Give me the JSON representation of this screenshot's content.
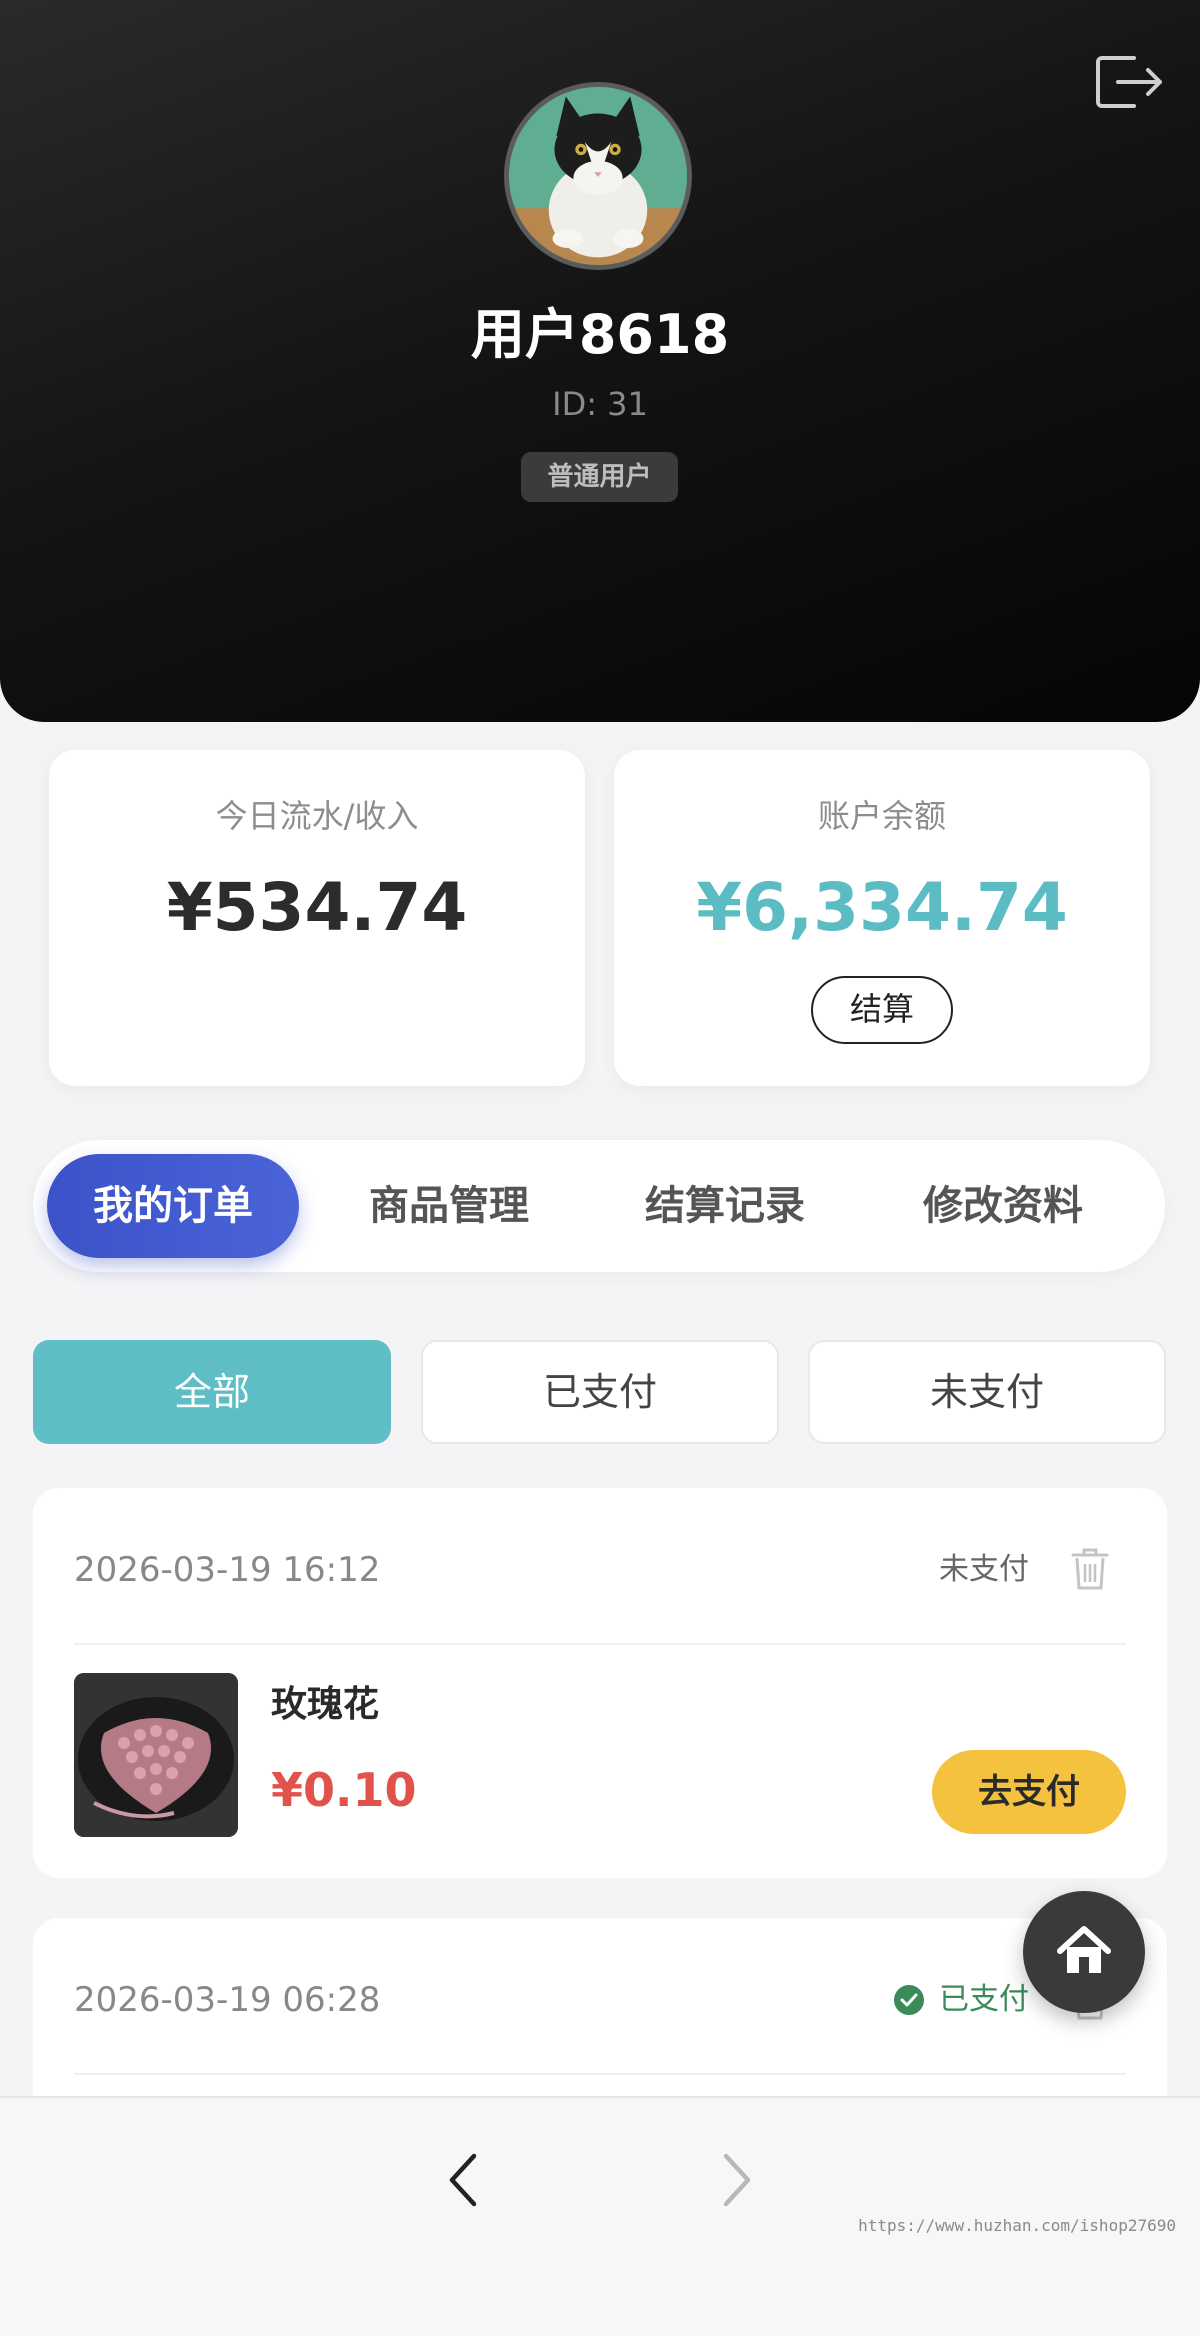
{
  "profile": {
    "name": "用户8618",
    "id_label": "ID: 31",
    "role": "普通用户"
  },
  "stats": {
    "today_label": "今日流水/收入",
    "today_value": "¥534.74",
    "balance_label": "账户余额",
    "balance_value": "¥6,334.74",
    "settle_label": "结算"
  },
  "nav_tabs": [
    {
      "label": "我的订单",
      "active": true
    },
    {
      "label": "商品管理",
      "active": false
    },
    {
      "label": "结算记录",
      "active": false
    },
    {
      "label": "修改资料",
      "active": false
    }
  ],
  "filters": [
    {
      "label": "全部",
      "active": true
    },
    {
      "label": "已支付",
      "active": false
    },
    {
      "label": "未支付",
      "active": false
    }
  ],
  "orders": [
    {
      "date": "2026-03-19 16:12",
      "status": "未支付",
      "product_name": "玫瑰花",
      "price": "¥0.10",
      "action_label": "去支付"
    },
    {
      "date": "2026-03-19 06:28",
      "status": "已支付"
    }
  ],
  "watermark": "https://www.huzhan.com/ishop27690",
  "colors": {
    "accent_teal": "#5ebdc5",
    "accent_blue": "#3c52c8",
    "price_red": "#e0524a",
    "pay_yellow": "#f4c23e",
    "paid_green": "#3a8a5a"
  },
  "icons": [
    "logout-icon",
    "trash-icon",
    "check-circle-icon",
    "home-icon",
    "chevron-left-icon",
    "chevron-right-icon"
  ]
}
